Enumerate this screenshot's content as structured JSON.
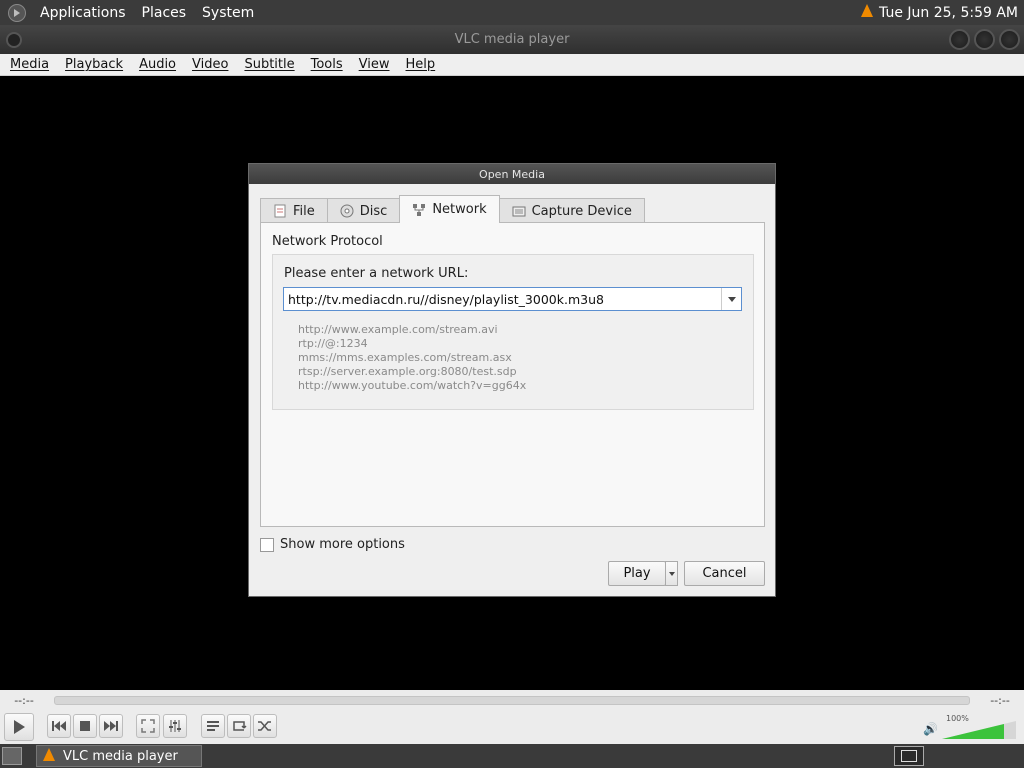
{
  "top_panel": {
    "menus": [
      "Applications",
      "Places",
      "System"
    ],
    "clock": "Tue Jun 25,  5:59 AM"
  },
  "window": {
    "title": "VLC media player"
  },
  "menubar": [
    "Media",
    "Playback",
    "Audio",
    "Video",
    "Subtitle",
    "Tools",
    "View",
    "Help"
  ],
  "dialog": {
    "title": "Open Media",
    "tabs": [
      {
        "label": "File",
        "icon": "file-icon"
      },
      {
        "label": "Disc",
        "icon": "disc-icon"
      },
      {
        "label": "Network",
        "icon": "network-icon",
        "active": true
      },
      {
        "label": "Capture Device",
        "icon": "capture-device-icon"
      }
    ],
    "protocol_heading": "Network Protocol",
    "url_label": "Please enter a network URL:",
    "url_value": "http://tv.mediacdn.ru//disney/playlist_3000k.m3u8",
    "examples": [
      "http://www.example.com/stream.avi",
      "rtp://@:1234",
      "mms://mms.examples.com/stream.asx",
      "rtsp://server.example.org:8080/test.sdp",
      "http://www.youtube.com/watch?v=gg64x"
    ],
    "show_more_options": "Show more options",
    "play_label": "Play",
    "cancel_label": "Cancel"
  },
  "controls": {
    "time_elapsed": "--:--",
    "time_total": "--:--",
    "volume_label": "100%",
    "volume": 100
  },
  "taskbar": {
    "task_label": "VLC media player"
  },
  "colors": {
    "accent_orange": "#f08a00",
    "volume_green": "#3cc33c",
    "focus_blue": "#5b8fd0"
  }
}
